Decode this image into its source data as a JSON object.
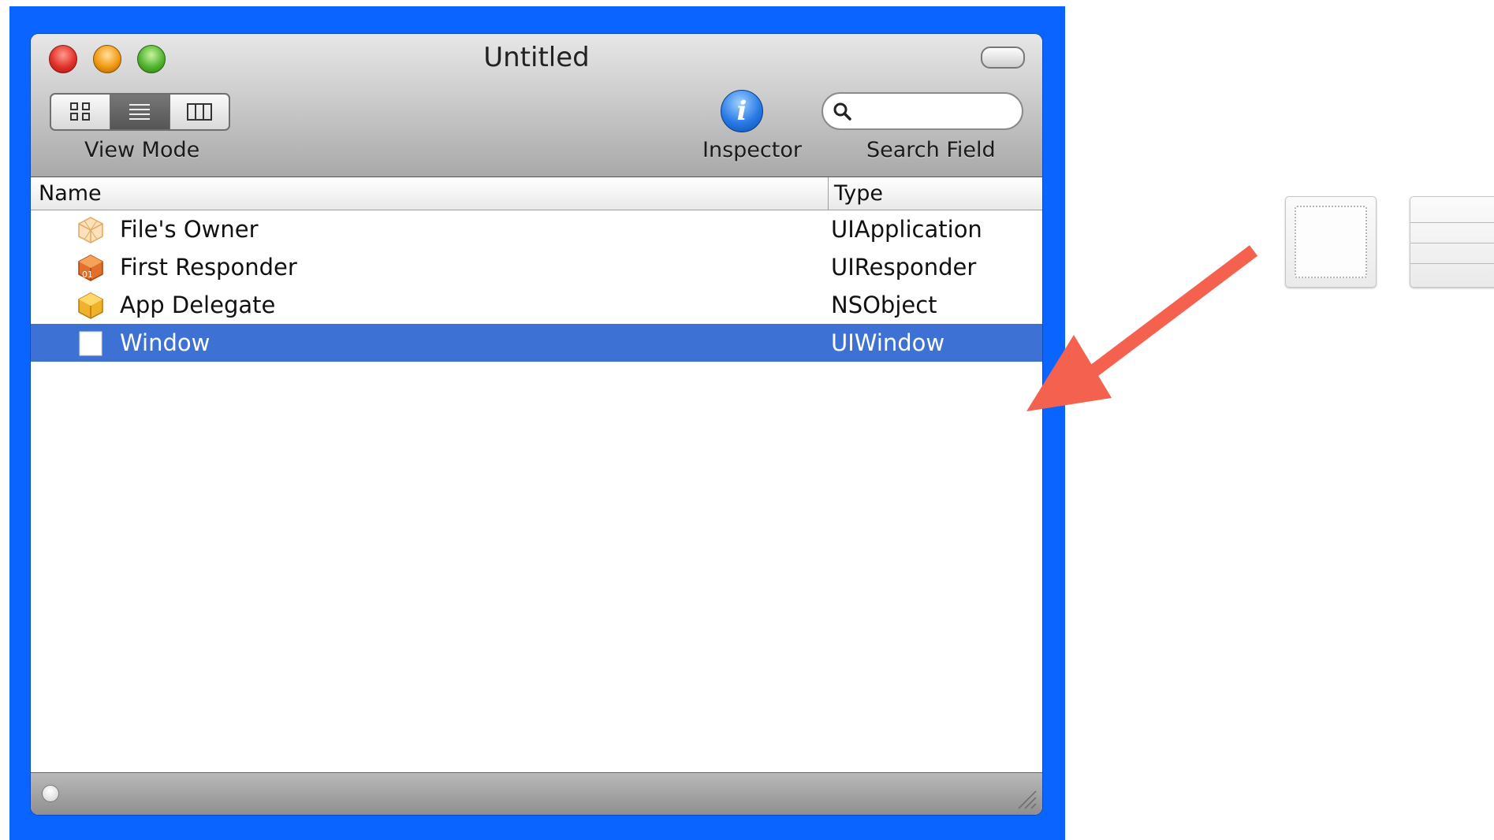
{
  "window": {
    "title": "Untitled"
  },
  "toolbar": {
    "view_mode_label": "View Mode",
    "view_mode_segments": [
      "icon-view",
      "list-view",
      "column-view"
    ],
    "view_mode_selected": "list-view",
    "inspector_label": "Inspector",
    "search_label": "Search Field",
    "search_value": ""
  },
  "table": {
    "columns": {
      "name": "Name",
      "type": "Type"
    },
    "rows": [
      {
        "name": "File's Owner",
        "type": "UIApplication",
        "icon": "files-owner-cube-icon",
        "selected": false
      },
      {
        "name": "First Responder",
        "type": "UIResponder",
        "icon": "first-responder-cube-icon",
        "selected": false
      },
      {
        "name": "App Delegate",
        "type": "NSObject",
        "icon": "object-cube-icon",
        "selected": false
      },
      {
        "name": "Window",
        "type": "UIWindow",
        "icon": "window-icon",
        "selected": true
      }
    ]
  },
  "colors": {
    "highlight_frame": "#0a64ff",
    "selection": "#3d72d4",
    "annotation_arrow": "#f5614f"
  }
}
